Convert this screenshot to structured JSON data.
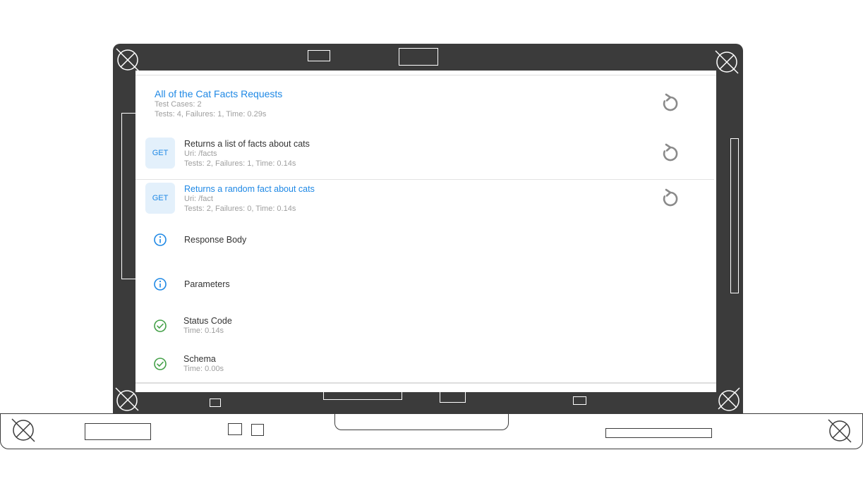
{
  "suite": {
    "title": "All of the Cat Facts Requests",
    "test_cases": "Test Cases: 2",
    "summary": "Tests: 4, Failures: 1, Time: 0.29s"
  },
  "requests": [
    {
      "method": "GET",
      "title": "Returns a list of facts about cats",
      "uri": "Uri: /facts",
      "summary": "Tests: 2, Failures: 1, Time: 0.14s"
    },
    {
      "method": "GET",
      "title": "Returns a random fact about cats",
      "uri": "Uri: /fact",
      "summary": "Tests: 2, Failures: 0, Time: 0.14s"
    }
  ],
  "checks": [
    {
      "label": "Response Body",
      "icon": "info-icon"
    },
    {
      "label": "Parameters",
      "icon": "info-icon"
    },
    {
      "label": "Status Code",
      "time": "Time: 0.14s",
      "icon": "check-circle-icon"
    },
    {
      "label": "Schema",
      "time": "Time: 0.00s",
      "icon": "check-circle-icon"
    }
  ],
  "colors": {
    "accent": "#1e88e5",
    "success": "#43a047",
    "bezel": "#3b3b3b",
    "muted": "#9e9e9e"
  }
}
